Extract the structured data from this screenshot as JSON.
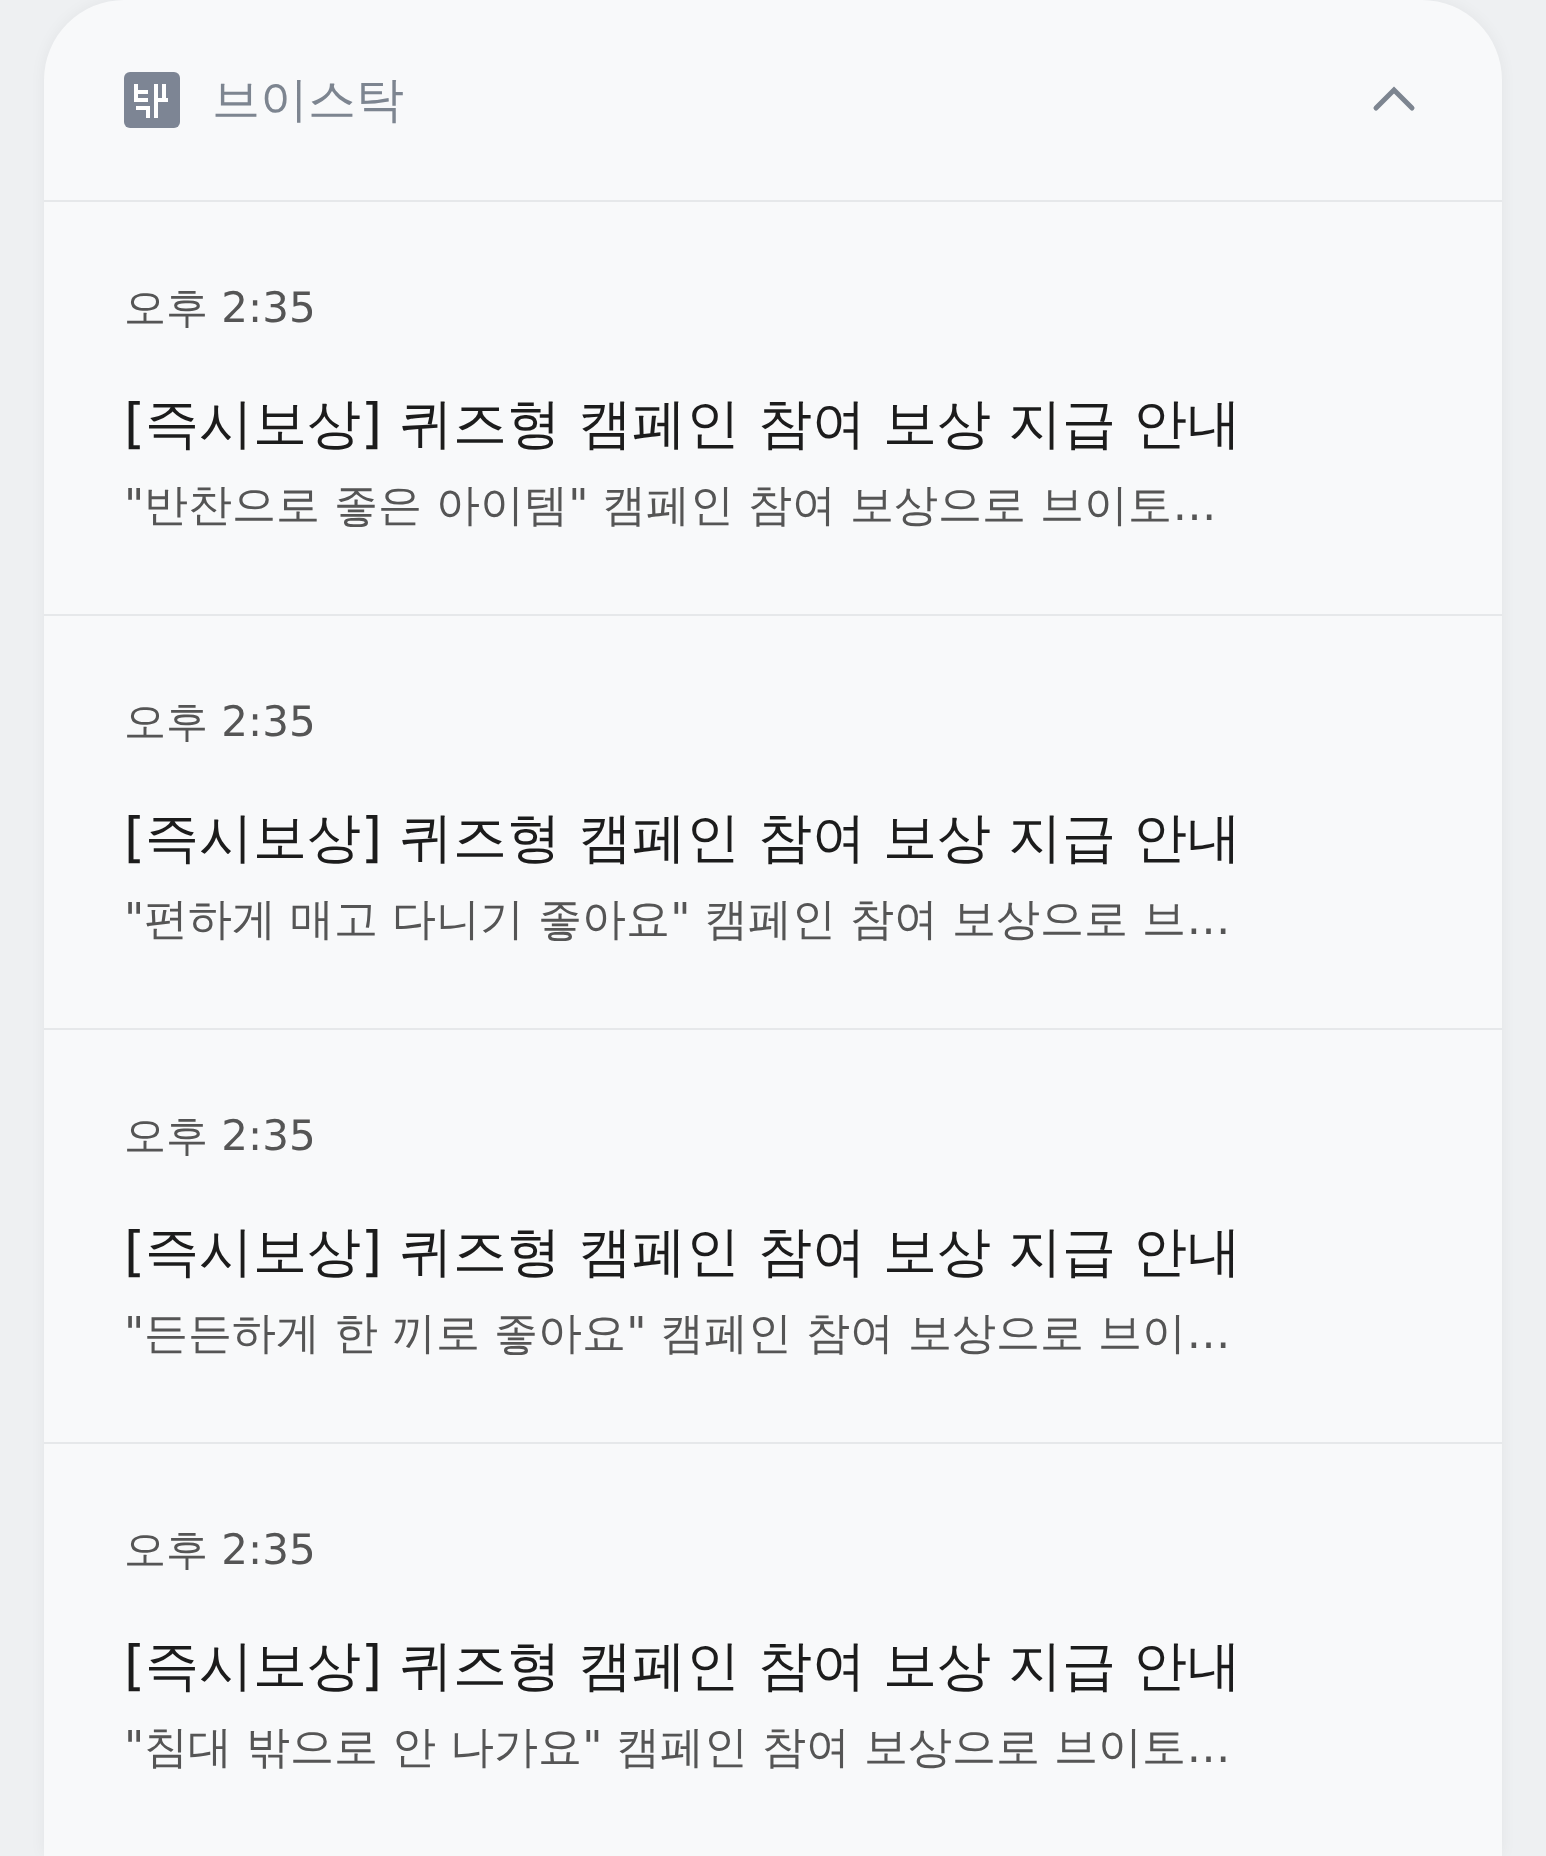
{
  "header": {
    "app_name": "브이스탁",
    "expanded": true
  },
  "notifications": [
    {
      "time": "오후 2:35",
      "title": "[즉시보상] 퀴즈형 캠페인 참여 보상 지급 안내",
      "body": "\"반찬으로 좋은 아이템\" 캠페인 참여 보상으로 브이토…"
    },
    {
      "time": "오후 2:35",
      "title": "[즉시보상] 퀴즈형 캠페인 참여 보상 지급 안내",
      "body": "\"편하게 매고 다니기 좋아요\" 캠페인 참여 보상으로 브…"
    },
    {
      "time": "오후 2:35",
      "title": "[즉시보상] 퀴즈형 캠페인 참여 보상 지급 안내",
      "body": "\"든든하게 한 끼로 좋아요\" 캠페인 참여 보상으로 브이…"
    },
    {
      "time": "오후 2:35",
      "title": "[즉시보상] 퀴즈형 캠페인 참여 보상 지급 안내",
      "body": "\"침대 밖으로 안 나가요\" 캠페인 참여 보상으로 브이토…"
    }
  ]
}
